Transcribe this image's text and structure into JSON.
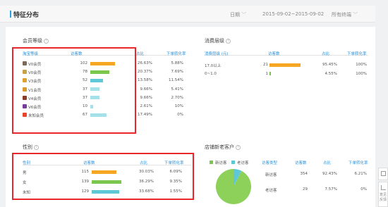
{
  "header": {
    "title": "特征分布",
    "date_label": "日期",
    "date_range": "2015-09-02~2015-09-02",
    "platform": "所有终端"
  },
  "member_level": {
    "title": "会员等级",
    "help": "?",
    "columns": [
      "淘宝等级",
      "访客数",
      "占比",
      "下单转化率"
    ],
    "rows": [
      {
        "level": "V0会员",
        "visitors": "102",
        "share": "26.63%",
        "conversion": "5.88%",
        "bar": 0.77,
        "icon_color": "#7b6a5a"
      },
      {
        "level": "V0会员",
        "visitors": "78",
        "share": "20.37%",
        "conversion": "7.69%",
        "bar": 0.59,
        "icon_color": "#c8a24a"
      },
      {
        "level": "V3会员",
        "visitors": "52",
        "share": "13.58%",
        "conversion": "11.54%",
        "bar": 0.39,
        "icon_color": "#e0a030"
      },
      {
        "level": "V1会员",
        "visitors": "37",
        "share": "9.66%",
        "conversion": "5.41%",
        "bar": 0.28,
        "icon_color": "#d89a2a"
      },
      {
        "level": "V4会员",
        "visitors": "37",
        "share": "9.66%",
        "conversion": "2.70%",
        "bar": 0.28,
        "icon_color": "#8a3c2a"
      },
      {
        "level": "V6会员",
        "visitors": "10",
        "share": "2.61%",
        "conversion": "10%",
        "bar": 0.08,
        "icon_color": "#7a3c9a"
      },
      {
        "level": "未知会员",
        "visitors": "67",
        "share": "17.49%",
        "conversion": "0%",
        "bar": 0.51,
        "icon_color": "#e8452a"
      }
    ]
  },
  "consumption": {
    "title": "消费层级",
    "help": "?",
    "columns": [
      "消费层级 (元)",
      "访客数",
      "占比",
      "下单转化率"
    ],
    "rows": [
      {
        "level": "17.0以上",
        "visitors": "21",
        "share": "95.45%",
        "conversion": "100%",
        "bar": 0.95
      },
      {
        "level": "0~1.0",
        "visitors": "1",
        "share": "4.55%",
        "conversion": "100%",
        "bar": 0.05
      }
    ]
  },
  "gender": {
    "title": "性别",
    "help": "?",
    "columns": [
      "性别",
      "访客数",
      "占比",
      "下单转化率"
    ],
    "rows": [
      {
        "label": "男",
        "visitors": "115",
        "share": "30.03%",
        "conversion": "6.09%",
        "bar": 0.75
      },
      {
        "label": "女",
        "visitors": "139",
        "share": "36.29%",
        "conversion": "9.35%",
        "bar": 0.91
      },
      {
        "label": "未知",
        "visitors": "129",
        "share": "33.68%",
        "conversion": "1.55%",
        "bar": 0.84
      }
    ]
  },
  "new_old": {
    "title": "店铺新老客户",
    "help": "?",
    "legend": [
      "新访客",
      "老访客"
    ],
    "columns": [
      "访客类型",
      "访客数",
      "占比",
      "下单转化率"
    ],
    "rows": [
      {
        "type": "新访客",
        "visitors": "354",
        "share": "92.43%",
        "conversion": "6.21%"
      },
      {
        "type": "老访客",
        "visitors": "29",
        "share": "7.57%",
        "conversion": "0%"
      }
    ],
    "pie": [
      92.43,
      7.57
    ]
  },
  "colors": {
    "accent": "#2aa0e6",
    "orange": "#f5a623",
    "green": "#7bc74d",
    "cyan": "#5fc8d6",
    "light_cyan": "#a6e0e8",
    "red_box": "#e8262b"
  },
  "sidebar": {
    "feedback_line1": "意见",
    "feedback_line2": "反馈"
  }
}
